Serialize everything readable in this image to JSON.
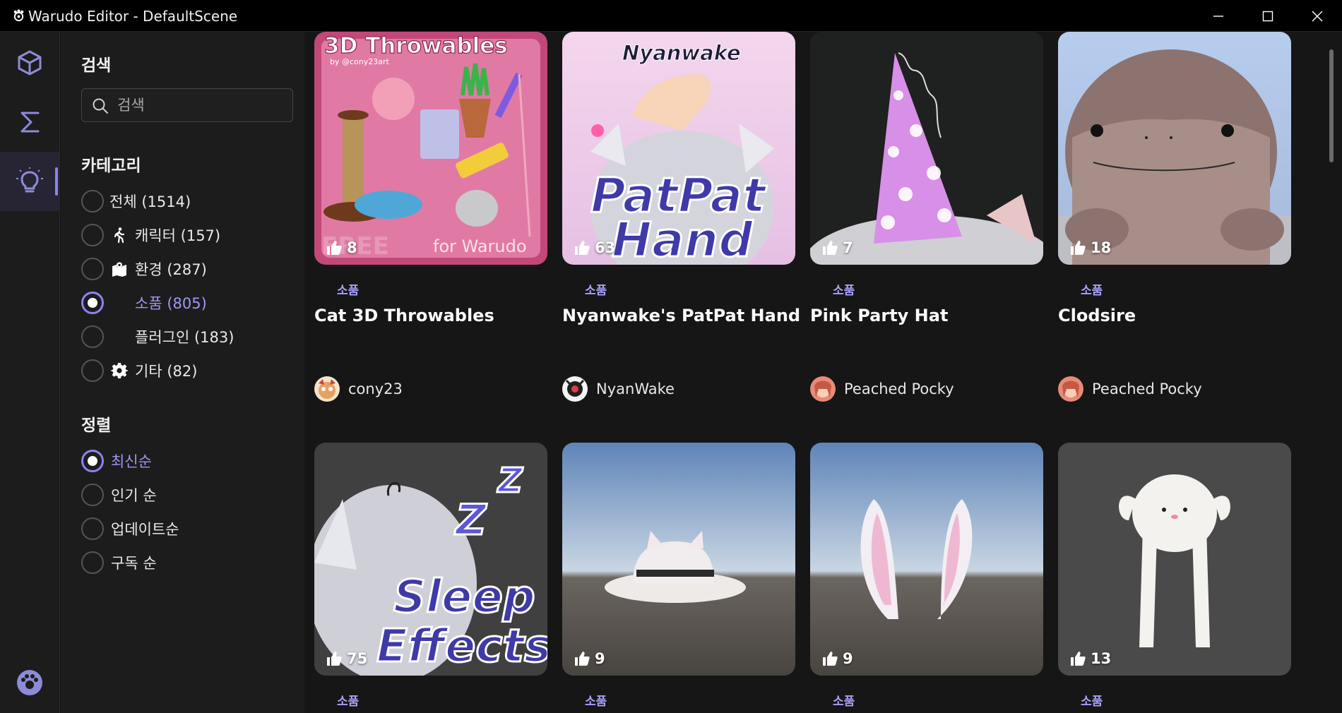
{
  "window": {
    "title": "Warudo Editor - DefaultScene",
    "icon": "warudo-logo-icon",
    "controls": [
      "minimize-icon",
      "maximize-icon",
      "close-icon"
    ]
  },
  "rail": {
    "items": [
      {
        "name": "cube-icon",
        "active": false
      },
      {
        "name": "sigma-icon",
        "active": false
      },
      {
        "name": "lightbulb-icon",
        "active": true
      }
    ],
    "bottom": "warudo-paw-icon"
  },
  "sidebar": {
    "search_title": "검색",
    "search_placeholder": "검색",
    "category_title": "카테고리",
    "categories": [
      {
        "label": "전체 (1514)",
        "icon": "",
        "checked": false
      },
      {
        "label": "캐릭터 (157)",
        "icon": "walk-icon",
        "checked": false
      },
      {
        "label": "환경 (287)",
        "icon": "map-icon",
        "checked": false
      },
      {
        "label": "소품 (805)",
        "icon": "",
        "checked": true
      },
      {
        "label": "플러그인 (183)",
        "icon": "",
        "checked": false
      },
      {
        "label": "기타 (82)",
        "icon": "gear-icon",
        "checked": false
      }
    ],
    "sort_title": "정렬",
    "sorts": [
      {
        "label": "최신순",
        "checked": true
      },
      {
        "label": "인기 순",
        "checked": false
      },
      {
        "label": "업데이트순",
        "checked": false
      },
      {
        "label": "구독 순",
        "checked": false
      }
    ]
  },
  "items": [
    {
      "category": "소품",
      "title": "Cat 3D Throwables",
      "likes": "8",
      "author": "cony23",
      "thumb_text": [
        "3D Throwables",
        "by @cony23art",
        "FREE",
        "for Warudo"
      ]
    },
    {
      "category": "소품",
      "title": "Nyanwake's PatPat Hand",
      "likes": "63",
      "author": "NyanWake",
      "thumb_text": [
        "Nyanwake",
        "PatPat",
        "Hand"
      ]
    },
    {
      "category": "소품",
      "title": "Pink Party Hat",
      "likes": "7",
      "author": "Peached Pocky",
      "thumb_text": []
    },
    {
      "category": "소품",
      "title": "Clodsire",
      "likes": "18",
      "author": "Peached Pocky",
      "thumb_text": []
    },
    {
      "category": "소품",
      "title": "",
      "likes": "75",
      "author": "",
      "thumb_text": [
        "Sleep",
        "Effects"
      ]
    },
    {
      "category": "소품",
      "title": "",
      "likes": "9",
      "author": "",
      "thumb_text": []
    },
    {
      "category": "소품",
      "title": "",
      "likes": "9",
      "author": "",
      "thumb_text": []
    },
    {
      "category": "소품",
      "title": "",
      "likes": "13",
      "author": "",
      "thumb_text": []
    }
  ],
  "colors": {
    "accent": "#8b83f0",
    "category_text": "#a7a0f6",
    "background": "#161616",
    "panel": "#1c1c1c"
  }
}
